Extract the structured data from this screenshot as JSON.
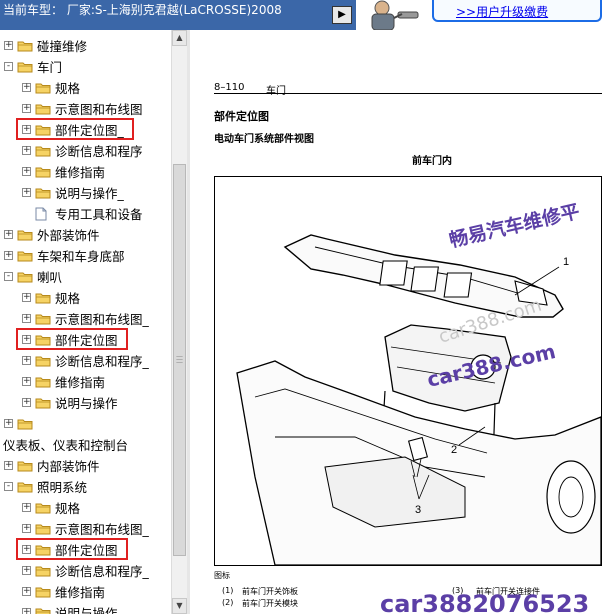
{
  "top_bar": {
    "car_model_label": "当前车型： 厂家:S-上海别克君越(LaCROSSE)2008",
    "upgrade_link": ">>用户升级缴费"
  },
  "tree": {
    "items": [
      {
        "label": "碰撞维修",
        "type": "folder",
        "expander": "+",
        "highlighted": false
      },
      {
        "label": "车门",
        "type": "folder",
        "expander": "-",
        "highlighted": false
      },
      {
        "label": "规格",
        "type": "folder",
        "expander": "+",
        "highlighted": false
      },
      {
        "label": "示意图和布线图",
        "type": "folder",
        "expander": "+",
        "highlighted": false
      },
      {
        "label": "部件定位图_",
        "type": "folder",
        "expander": "+",
        "highlighted": true
      },
      {
        "label": "诊断信息和程序",
        "type": "folder",
        "expander": "+",
        "highlighted": false
      },
      {
        "label": "维修指南",
        "type": "folder",
        "expander": "+",
        "highlighted": false
      },
      {
        "label": "说明与操作_",
        "type": "folder",
        "expander": "+",
        "highlighted": false
      },
      {
        "label": "专用工具和设备",
        "type": "document",
        "expander": "",
        "highlighted": false
      },
      {
        "label": "外部装饰件",
        "type": "folder",
        "expander": "+",
        "highlighted": false
      },
      {
        "label": "车架和车身底部",
        "type": "folder",
        "expander": "+",
        "highlighted": false
      },
      {
        "label": "喇叭",
        "type": "folder",
        "expander": "-",
        "highlighted": false
      },
      {
        "label": "规格",
        "type": "folder",
        "expander": "+",
        "highlighted": false
      },
      {
        "label": "示意图和布线图_",
        "type": "folder",
        "expander": "+",
        "highlighted": false
      },
      {
        "label": "部件定位图",
        "type": "folder",
        "expander": "+",
        "highlighted": true
      },
      {
        "label": "诊断信息和程序_",
        "type": "folder",
        "expander": "+",
        "highlighted": false
      },
      {
        "label": "维修指南",
        "type": "folder",
        "expander": "+",
        "highlighted": false
      },
      {
        "label": "说明与操作",
        "type": "folder",
        "expander": "+",
        "highlighted": false
      },
      {
        "label": "",
        "type": "folder",
        "expander": "+",
        "highlighted": false
      },
      {
        "label": "仪表板、仪表和控制台",
        "type": "text",
        "expander": "",
        "highlighted": false
      },
      {
        "label": "内部装饰件",
        "type": "folder",
        "expander": "+",
        "highlighted": false
      },
      {
        "label": "照明系统",
        "type": "folder",
        "expander": "-",
        "highlighted": false
      },
      {
        "label": "规格",
        "type": "folder",
        "expander": "+",
        "highlighted": false
      },
      {
        "label": "示意图和布线图_",
        "type": "folder",
        "expander": "+",
        "highlighted": false
      },
      {
        "label": "部件定位图",
        "type": "folder",
        "expander": "+",
        "highlighted": true
      },
      {
        "label": "诊断信息和程序_",
        "type": "folder",
        "expander": "+",
        "highlighted": false
      },
      {
        "label": "维修指南",
        "type": "folder",
        "expander": "+",
        "highlighted": false
      },
      {
        "label": "说明与操作",
        "type": "folder",
        "expander": "+",
        "highlighted": false
      }
    ]
  },
  "document": {
    "page_number": "8–110",
    "chapter": "车门",
    "section_title": "部件定位图",
    "subsection_title": "电动车门系统部件视图",
    "figure_caption": "前车门内",
    "callouts": [
      "1",
      "2",
      "3"
    ],
    "watermark_lines": [
      "畅易汽车维修平",
      "car388.com",
      "car388.com"
    ],
    "watermark_bottom": "car3882076523",
    "legend_heading": "图标",
    "legend": [
      {
        "num": "(1)",
        "text": "前车门开关饰板"
      },
      {
        "num": "(2)",
        "text": "前车门开关模块"
      },
      {
        "num": "(3)",
        "text": "前车门开关连接件"
      }
    ]
  },
  "colors": {
    "car_bar": "#3b67a8",
    "highlight": "#e02020",
    "link": "#0000ee",
    "watermark": "#5b3fa6"
  }
}
